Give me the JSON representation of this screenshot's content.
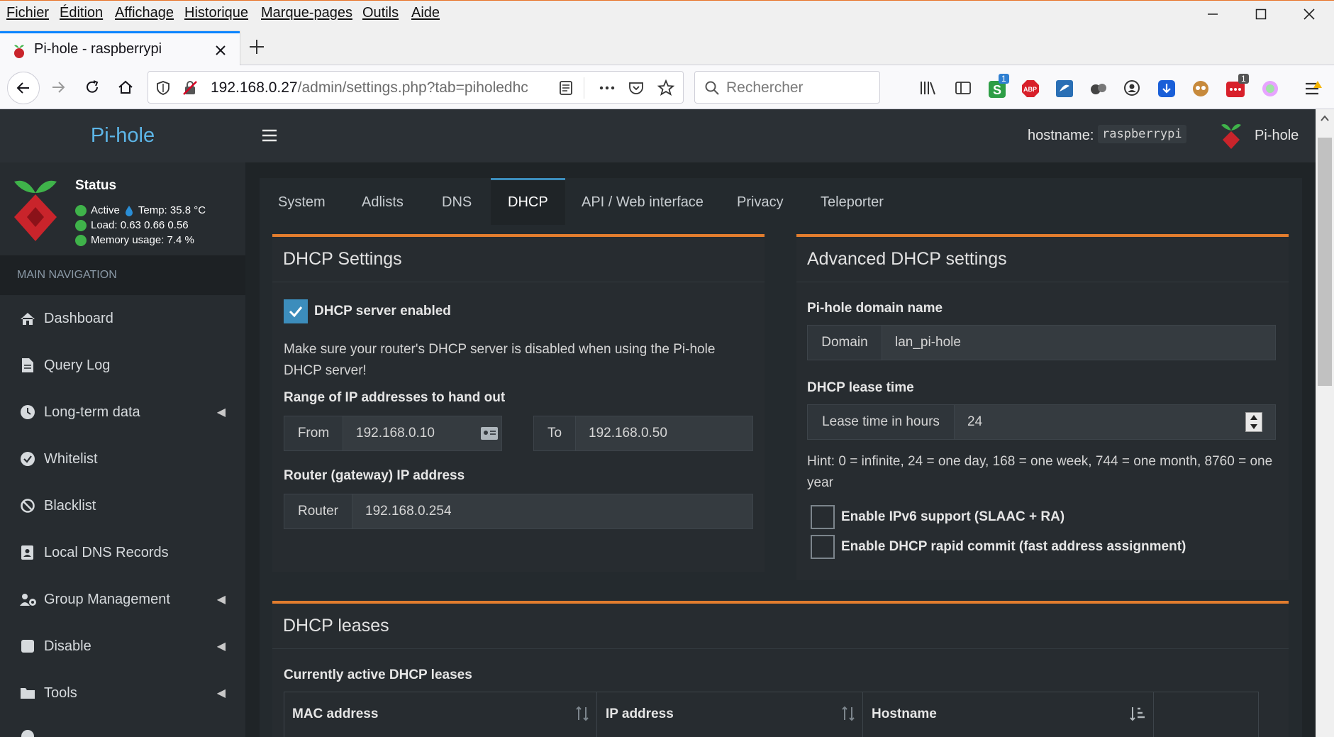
{
  "menubar": {
    "items": [
      "Fichier",
      "Édition",
      "Affichage",
      "Historique",
      "Marque-pages",
      "Outils",
      "Aide"
    ]
  },
  "browser": {
    "tab_title": "Pi-hole - raspberrypi",
    "url_host": "192.168.0.27",
    "url_path": "/admin/settings.php?tab=piholedhc",
    "search_placeholder": "Rechercher",
    "badge_count_1": "1",
    "badge_count_2": "1",
    "abp_label": "ABP"
  },
  "app": {
    "brand": "Pi-hole",
    "hostname_label": "hostname:",
    "hostname_value": "raspberrypi",
    "user_label": "Pi-hole"
  },
  "status": {
    "title": "Status",
    "active": "Active",
    "temp": "Temp: 35.8 °C",
    "load": "Load:  0.63  0.66  0.56",
    "memory": "Memory usage:  7.4 %"
  },
  "nav": {
    "header": "MAIN NAVIGATION",
    "items": [
      {
        "label": "Dashboard",
        "icon": "home-icon"
      },
      {
        "label": "Query Log",
        "icon": "file-icon"
      },
      {
        "label": "Long-term data",
        "icon": "clock-icon",
        "has_submenu": true
      },
      {
        "label": "Whitelist",
        "icon": "check-circle-icon"
      },
      {
        "label": "Blacklist",
        "icon": "ban-icon"
      },
      {
        "label": "Local DNS Records",
        "icon": "address-book-icon"
      },
      {
        "label": "Group Management",
        "icon": "users-cog-icon",
        "has_submenu": true
      },
      {
        "label": "Disable",
        "icon": "stop-icon",
        "has_submenu": true
      },
      {
        "label": "Tools",
        "icon": "folder-icon",
        "has_submenu": true
      }
    ]
  },
  "settings_tabs": [
    "System",
    "Adlists",
    "DNS",
    "DHCP",
    "API / Web interface",
    "Privacy",
    "Teleporter"
  ],
  "active_tab": "DHCP",
  "dhcp_settings": {
    "title": "DHCP Settings",
    "enabled_label": "DHCP server enabled",
    "enabled": true,
    "warning": "Make sure your router's DHCP server is disabled when using the Pi-hole DHCP server!",
    "range_label": "Range of IP addresses to hand out",
    "from_label": "From",
    "from_value": "192.168.0.10",
    "to_label": "To",
    "to_value": "192.168.0.50",
    "router_label": "Router (gateway) IP address",
    "router_addon": "Router",
    "router_value": "192.168.0.254"
  },
  "advanced_dhcp": {
    "title": "Advanced DHCP settings",
    "domain_label": "Pi-hole domain name",
    "domain_addon": "Domain",
    "domain_value": "lan_pi-hole",
    "lease_label": "DHCP lease time",
    "lease_addon": "Lease time in hours",
    "lease_value": "24",
    "hint": "Hint: 0 = infinite, 24 = one day, 168 = one week, 744 = one month, 8760 = one year",
    "ipv6_label": "Enable IPv6 support (SLAAC + RA)",
    "ipv6_enabled": false,
    "rapid_label": "Enable DHCP rapid commit (fast address assignment)",
    "rapid_enabled": false
  },
  "leases": {
    "title": "DHCP leases",
    "subtitle": "Currently active DHCP leases",
    "columns": [
      "MAC address",
      "IP address",
      "Hostname"
    ]
  },
  "colors": {
    "accent_orange": "#e27d2e",
    "accent_blue": "#3c8dbc",
    "brand_blue": "#5db6e8",
    "status_green": "#3fb34a",
    "sidebar_bg": "#272c30"
  }
}
